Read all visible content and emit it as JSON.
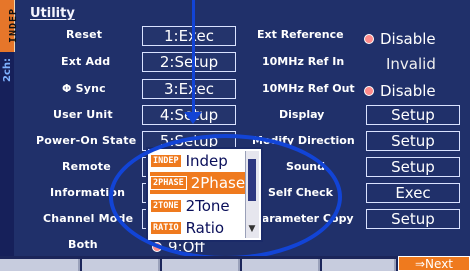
{
  "side": {
    "tab_label": "INDEP",
    "channel_label": "2ch:"
  },
  "title": "Utility",
  "left_rows": [
    {
      "label": "Reset",
      "value": "1:Exec"
    },
    {
      "label": "Ext Add",
      "value": "2:Setup"
    },
    {
      "label": "Φ Sync",
      "value": "3:Exec"
    },
    {
      "label": "User Unit",
      "value": "4:Setup"
    },
    {
      "label": "Power-On State",
      "value": "5:Setup"
    },
    {
      "label": "Remote",
      "value": ""
    },
    {
      "label": "Information",
      "value": ""
    },
    {
      "label": "Channel Mode",
      "value": ""
    },
    {
      "label": "Both",
      "value": "9:Off"
    }
  ],
  "right_rows": [
    {
      "label": "Ext Reference",
      "value": "Disable",
      "kind": "radio"
    },
    {
      "label": "10MHz Ref In",
      "value": "Invalid",
      "kind": "text"
    },
    {
      "label": "10MHz Ref Out",
      "value": "Disable",
      "kind": "radio"
    },
    {
      "label": "Display",
      "value": "Setup",
      "kind": "button"
    },
    {
      "label": "Modify Direction",
      "value": "Setup",
      "kind": "button"
    },
    {
      "label": "Sound",
      "value": "Setup",
      "kind": "button"
    },
    {
      "label": "Self Check",
      "value": "Exec",
      "kind": "button"
    },
    {
      "label": "Parameter Copy",
      "value": "Setup",
      "kind": "button"
    }
  ],
  "dropdown": {
    "items": [
      {
        "tag": "INDEP",
        "text": "Indep",
        "selected": false
      },
      {
        "tag": "2PHASE",
        "text": "2Phase",
        "selected": true
      },
      {
        "tag": "2TONE",
        "text": "2Tone",
        "selected": false
      },
      {
        "tag": "RATIO",
        "text": "Ratio",
        "selected": false
      }
    ]
  },
  "softkeys": {
    "next_label": "⇒Next"
  },
  "colors": {
    "background": "#20306a",
    "accent": "#ef7a1e",
    "annotation": "#1244d6",
    "radio": "#ff8b8b"
  }
}
